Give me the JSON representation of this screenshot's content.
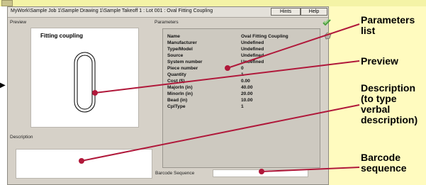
{
  "window": {
    "title": "MyWork\\Sample Job 1\\Sample Drawing 1\\Sample Takeoff 1 : Lot 001 : Oval Fitting Coupling",
    "hints_label": "Hints",
    "help_label": "Help"
  },
  "preview": {
    "label": "Preview",
    "title": "Fitting coupling"
  },
  "description": {
    "label": "Description",
    "value": ""
  },
  "parameters": {
    "label": "Parameters",
    "rows": [
      {
        "name": "Name",
        "value": "Oval Fitting Coupling"
      },
      {
        "name": "Manufacturer",
        "value": "Undefined"
      },
      {
        "name": "Type/Model",
        "value": "Undefined"
      },
      {
        "name": "Source",
        "value": "Undefined"
      },
      {
        "name": "System number",
        "value": "Undefined"
      },
      {
        "name": "Piece number",
        "value": "0"
      },
      {
        "name": "Quantity",
        "value": "1"
      },
      {
        "name": "Cost ($)",
        "value": "0.00"
      },
      {
        "name": "MajorIn (in)",
        "value": "40.00"
      },
      {
        "name": "MinorIn (in)",
        "value": "20.00"
      },
      {
        "name": "Bead (in)",
        "value": "10.00"
      },
      {
        "name": "CplType",
        "value": "1"
      }
    ]
  },
  "barcode": {
    "label": "Barcode Sequence",
    "value": ""
  },
  "icons": {
    "check": "check-icon",
    "gem": "gem-icon"
  },
  "callouts": {
    "parameters_line1": "Parameters",
    "parameters_line2": "list",
    "preview": "Preview",
    "description_line1": "Description",
    "description_line2": "(to type",
    "description_line3": "verbal",
    "description_line4": "description)",
    "barcode_line1": "Barcode",
    "barcode_line2": "sequence"
  },
  "colors": {
    "callout_background": "#fffbbf",
    "arrow": "#b0183a",
    "window_background": "#d6d1c8"
  }
}
